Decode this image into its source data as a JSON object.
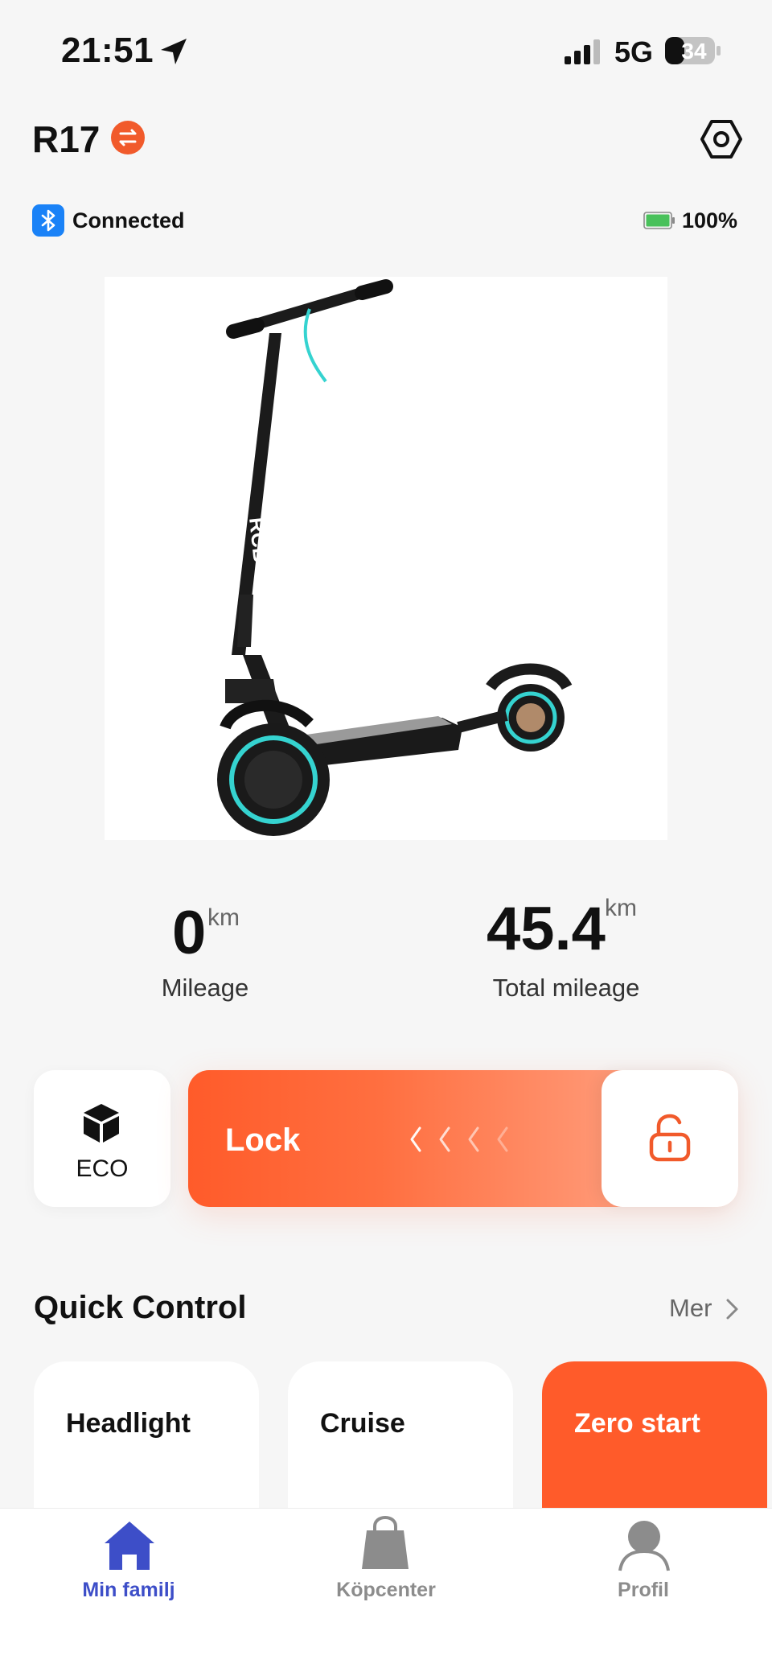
{
  "status_bar": {
    "time": "21:51",
    "network": "5G",
    "battery": "34"
  },
  "header": {
    "title": "R17",
    "connection_status": "Connected",
    "battery_percent": "100%"
  },
  "stats": {
    "mileage": {
      "value": "0",
      "unit": "km",
      "label": "Mileage"
    },
    "total_mileage": {
      "value": "45.4",
      "unit": "km",
      "label": "Total mileage"
    }
  },
  "controls": {
    "mode_label": "ECO",
    "lock_label": "Lock"
  },
  "quick_control": {
    "title": "Quick Control",
    "more_label": "Mer",
    "items": [
      {
        "label": "Headlight",
        "active": false
      },
      {
        "label": "Cruise",
        "active": false
      },
      {
        "label": "Zero start",
        "active": true
      }
    ]
  },
  "tabs": [
    {
      "label": "Min familj",
      "active": true
    },
    {
      "label": "Köpcenter",
      "active": false
    },
    {
      "label": "Profil",
      "active": false
    }
  ],
  "colors": {
    "accent": "#ff5b2a",
    "active_tab": "#3d4ec8",
    "bluetooth": "#1a82f7",
    "battery_green": "#49c15b"
  }
}
